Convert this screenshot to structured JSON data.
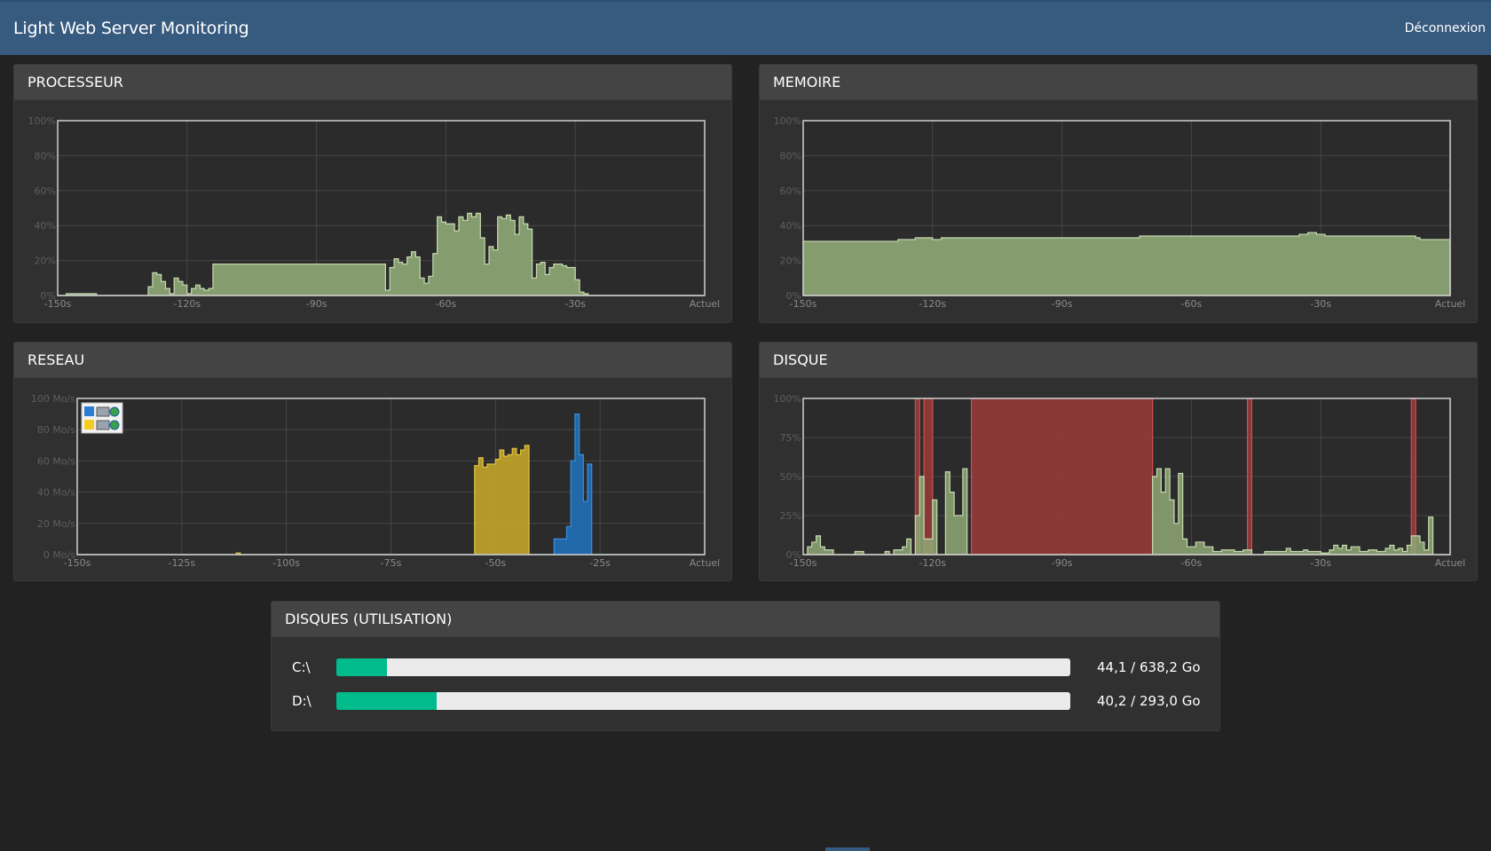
{
  "app": {
    "title": "Light Web Server Monitoring",
    "logout_label": "Déconnexion"
  },
  "colors": {
    "navbar": "#375a7f",
    "cpu": "#8fa876",
    "memory": "#8fa876",
    "network_send": "#c2a52a",
    "network_receive": "#1f6fb5",
    "disk_busy": "#9b3a3a",
    "disk_io": "#8fa876",
    "disk_usage": "#00bc8c"
  },
  "panels": {
    "cpu": {
      "title": "PROCESSEUR"
    },
    "memory": {
      "title": "MEMOIRE"
    },
    "network": {
      "title": "RESEAU",
      "legend_icons": [
        "network-send-icon",
        "network-receive-icon"
      ]
    },
    "disk": {
      "title": "DISQUE"
    },
    "disk_usage": {
      "title": "DISQUES (UTILISATION)",
      "drives": [
        {
          "label": "C:\\",
          "used": 44.1,
          "total": 638.2,
          "text": "44,1 / 638,2 Go"
        },
        {
          "label": "D:\\",
          "used": 40.2,
          "total": 293.0,
          "text": "40,2 / 293,0 Go"
        }
      ]
    }
  },
  "chart_data": [
    {
      "id": "cpu",
      "type": "area",
      "x_range": [
        -150,
        0
      ],
      "ylim": [
        0,
        100
      ],
      "yticks": [
        {
          "v": 0,
          "label": "0%"
        },
        {
          "v": 20,
          "label": "20%"
        },
        {
          "v": 40,
          "label": "40%"
        },
        {
          "v": 60,
          "label": "60%"
        },
        {
          "v": 80,
          "label": "80%"
        },
        {
          "v": 100,
          "label": "100%"
        }
      ],
      "xticks": [
        {
          "v": -150,
          "label": "-150s"
        },
        {
          "v": -120,
          "label": "-120s"
        },
        {
          "v": -90,
          "label": "-90s"
        },
        {
          "v": -60,
          "label": "-60s"
        },
        {
          "v": -30,
          "label": "-30s"
        },
        {
          "v": 0,
          "label": "Actuel"
        }
      ],
      "grid": true,
      "series": [
        {
          "values": [
            [
              -150,
              0
            ],
            [
              -148,
              1
            ],
            [
              -141,
              0
            ],
            [
              -129,
              5
            ],
            [
              -128,
              13
            ],
            [
              -127,
              12
            ],
            [
              -126,
              8
            ],
            [
              -125,
              4
            ],
            [
              -124,
              1
            ],
            [
              -123,
              10
            ],
            [
              -122,
              8
            ],
            [
              -121,
              6
            ],
            [
              -120,
              1
            ],
            [
              -119,
              4
            ],
            [
              -118,
              6
            ],
            [
              -117,
              4
            ],
            [
              -116,
              3
            ],
            [
              -115,
              4
            ],
            [
              -114,
              18
            ],
            [
              -75,
              18
            ],
            [
              -74,
              3
            ],
            [
              -73,
              16
            ],
            [
              -72,
              21
            ],
            [
              -71,
              19
            ],
            [
              -70,
              18
            ],
            [
              -69,
              22
            ],
            [
              -68,
              25
            ],
            [
              -67,
              22
            ],
            [
              -66,
              10
            ],
            [
              -65,
              7
            ],
            [
              -64,
              11
            ],
            [
              -63,
              24
            ],
            [
              -62,
              45
            ],
            [
              -61,
              42
            ],
            [
              -60,
              41
            ],
            [
              -59,
              41
            ],
            [
              -58,
              37
            ],
            [
              -57,
              45
            ],
            [
              -56,
              43
            ],
            [
              -55,
              47
            ],
            [
              -54,
              45
            ],
            [
              -53,
              47
            ],
            [
              -52,
              33
            ],
            [
              -51,
              18
            ],
            [
              -50,
              28
            ],
            [
              -49,
              26
            ],
            [
              -48,
              45
            ],
            [
              -47,
              44
            ],
            [
              -46,
              46
            ],
            [
              -45,
              43
            ],
            [
              -44,
              35
            ],
            [
              -43,
              45
            ],
            [
              -42,
              41
            ],
            [
              -41,
              38
            ],
            [
              -40,
              10
            ],
            [
              -39,
              18
            ],
            [
              -38,
              19
            ],
            [
              -37,
              12
            ],
            [
              -36,
              16
            ],
            [
              -35,
              18
            ],
            [
              -34,
              18
            ],
            [
              -33,
              17
            ],
            [
              -32,
              16
            ],
            [
              -31,
              16
            ],
            [
              -30,
              9
            ],
            [
              -29,
              2
            ],
            [
              -28,
              1
            ],
            [
              -27,
              0
            ],
            [
              -26,
              0
            ],
            [
              -25,
              0
            ]
          ]
        }
      ]
    },
    {
      "id": "memory",
      "type": "area",
      "x_range": [
        -150,
        0
      ],
      "ylim": [
        0,
        100
      ],
      "yticks": [
        {
          "v": 0,
          "label": "0%"
        },
        {
          "v": 20,
          "label": "20%"
        },
        {
          "v": 40,
          "label": "40%"
        },
        {
          "v": 60,
          "label": "60%"
        },
        {
          "v": 80,
          "label": "80%"
        },
        {
          "v": 100,
          "label": "100%"
        }
      ],
      "xticks": [
        {
          "v": -150,
          "label": "-150s"
        },
        {
          "v": -120,
          "label": "-120s"
        },
        {
          "v": -90,
          "label": "-90s"
        },
        {
          "v": -60,
          "label": "-60s"
        },
        {
          "v": -30,
          "label": "-30s"
        },
        {
          "v": 0,
          "label": "Actuel"
        }
      ],
      "grid": true,
      "series": [
        {
          "values": [
            [
              -150,
              31
            ],
            [
              -128,
              32
            ],
            [
              -124,
              33
            ],
            [
              -120,
              32
            ],
            [
              -118,
              33
            ],
            [
              -75,
              33
            ],
            [
              -72,
              34
            ],
            [
              -37,
              34
            ],
            [
              -35,
              35
            ],
            [
              -33,
              36
            ],
            [
              -31,
              35
            ],
            [
              -29,
              34
            ],
            [
              -9,
              34
            ],
            [
              -8,
              33
            ],
            [
              -7,
              32
            ],
            [
              0,
              32
            ]
          ]
        }
      ]
    },
    {
      "id": "network",
      "type": "area",
      "x_range": [
        -150,
        0
      ],
      "ylim": [
        0,
        100
      ],
      "yticks": [
        {
          "v": 0,
          "label": "0 Mo/s"
        },
        {
          "v": 20,
          "label": "20 Mo/s"
        },
        {
          "v": 40,
          "label": "40 Mo/s"
        },
        {
          "v": 60,
          "label": "60 Mo/s"
        },
        {
          "v": 80,
          "label": "80 Mo/s"
        },
        {
          "v": 100,
          "label": "100 Mo/s"
        }
      ],
      "xticks": [
        {
          "v": -150,
          "label": "-150s"
        },
        {
          "v": -125,
          "label": "-125s"
        },
        {
          "v": -100,
          "label": "-100s"
        },
        {
          "v": -75,
          "label": "-75s"
        },
        {
          "v": -50,
          "label": "-50s"
        },
        {
          "v": -25,
          "label": "-25s"
        },
        {
          "v": 0,
          "label": "Actuel"
        }
      ],
      "grid": true,
      "series": [
        {
          "id": "send",
          "values": [
            [
              -150,
              0
            ],
            [
              -112,
              1
            ],
            [
              -111,
              0
            ],
            [
              -56,
              0
            ],
            [
              -55,
              57
            ],
            [
              -54,
              62
            ],
            [
              -53,
              56
            ],
            [
              -52,
              58
            ],
            [
              -51,
              58
            ],
            [
              -50,
              61
            ],
            [
              -49,
              67
            ],
            [
              -48,
              63
            ],
            [
              -47,
              64
            ],
            [
              -46,
              68
            ],
            [
              -45,
              64
            ],
            [
              -44,
              67
            ],
            [
              -43,
              70
            ],
            [
              -42,
              0
            ],
            [
              0,
              0
            ]
          ]
        },
        {
          "id": "receive",
          "values": [
            [
              -150,
              0
            ],
            [
              -37,
              0
            ],
            [
              -36,
              10
            ],
            [
              -34,
              10
            ],
            [
              -33,
              18
            ],
            [
              -32,
              60
            ],
            [
              -31,
              90
            ],
            [
              -30,
              64
            ],
            [
              -29,
              34
            ],
            [
              -28,
              58
            ],
            [
              -27,
              0
            ],
            [
              0,
              0
            ]
          ]
        }
      ]
    },
    {
      "id": "disk",
      "type": "area",
      "x_range": [
        -150,
        0
      ],
      "ylim": [
        0,
        100
      ],
      "yticks": [
        {
          "v": 0,
          "label": "0%"
        },
        {
          "v": 25,
          "label": "25%"
        },
        {
          "v": 50,
          "label": "50%"
        },
        {
          "v": 75,
          "label": "75%"
        },
        {
          "v": 100,
          "label": "100%"
        }
      ],
      "xticks": [
        {
          "v": -150,
          "label": "-150s"
        },
        {
          "v": -120,
          "label": "-120s"
        },
        {
          "v": -90,
          "label": "-90s"
        },
        {
          "v": -60,
          "label": "-60s"
        },
        {
          "v": -30,
          "label": "-30s"
        },
        {
          "v": 0,
          "label": "Actuel"
        }
      ],
      "grid": true,
      "series": [
        {
          "id": "busy",
          "values": [
            [
              -150,
              0
            ],
            [
              -125,
              0
            ],
            [
              -124,
              100
            ],
            [
              -123,
              0
            ],
            [
              -122,
              100
            ],
            [
              -120,
              0
            ],
            [
              -112,
              0
            ],
            [
              -111,
              100
            ],
            [
              -70,
              100
            ],
            [
              -69,
              0
            ],
            [
              -48,
              0
            ],
            [
              -47,
              100
            ],
            [
              -46,
              0
            ],
            [
              -10,
              0
            ],
            [
              -9,
              100
            ],
            [
              -8,
              0
            ],
            [
              0,
              0
            ]
          ]
        },
        {
          "id": "io",
          "values": [
            [
              -150,
              0
            ],
            [
              -149,
              5
            ],
            [
              -148,
              8
            ],
            [
              -147,
              12
            ],
            [
              -146,
              5
            ],
            [
              -145,
              3
            ],
            [
              -143,
              0
            ],
            [
              -138,
              2
            ],
            [
              -136,
              0
            ],
            [
              -131,
              2
            ],
            [
              -130,
              0
            ],
            [
              -129,
              3
            ],
            [
              -127,
              5
            ],
            [
              -126,
              10
            ],
            [
              -125,
              0
            ],
            [
              -124,
              25
            ],
            [
              -123,
              50
            ],
            [
              -122,
              10
            ],
            [
              -120,
              35
            ],
            [
              -119,
              0
            ],
            [
              -117,
              53
            ],
            [
              -116,
              40
            ],
            [
              -115,
              25
            ],
            [
              -113,
              55
            ],
            [
              -112,
              0
            ],
            [
              -70,
              0
            ],
            [
              -69,
              50
            ],
            [
              -68,
              55
            ],
            [
              -67,
              40
            ],
            [
              -66,
              55
            ],
            [
              -65,
              35
            ],
            [
              -64,
              20
            ],
            [
              -63,
              52
            ],
            [
              -62,
              10
            ],
            [
              -61,
              5
            ],
            [
              -59,
              8
            ],
            [
              -57,
              5
            ],
            [
              -55,
              2
            ],
            [
              -53,
              3
            ],
            [
              -50,
              2
            ],
            [
              -48,
              3
            ],
            [
              -46,
              0
            ],
            [
              -43,
              2
            ],
            [
              -41,
              2
            ],
            [
              -38,
              4
            ],
            [
              -37,
              2
            ],
            [
              -34,
              3
            ],
            [
              -33,
              2
            ],
            [
              -30,
              1
            ],
            [
              -28,
              3
            ],
            [
              -27,
              6
            ],
            [
              -26,
              4
            ],
            [
              -25,
              6
            ],
            [
              -24,
              3
            ],
            [
              -23,
              5
            ],
            [
              -21,
              2
            ],
            [
              -19,
              3
            ],
            [
              -17,
              2
            ],
            [
              -15,
              4
            ],
            [
              -14,
              6
            ],
            [
              -13,
              3
            ],
            [
              -12,
              4
            ],
            [
              -11,
              2
            ],
            [
              -10,
              6
            ],
            [
              -9,
              12
            ],
            [
              -7,
              8
            ],
            [
              -6,
              3
            ],
            [
              -5,
              24
            ],
            [
              -4,
              0
            ],
            [
              0,
              0
            ]
          ]
        }
      ]
    }
  ]
}
